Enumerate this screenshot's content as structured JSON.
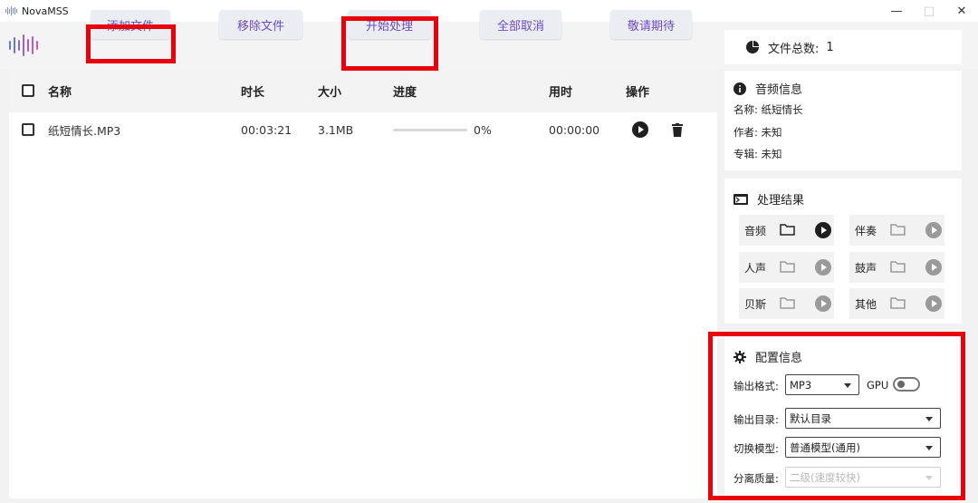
{
  "window": {
    "title": "NovaMSS",
    "minimize": "—",
    "maximize": "□",
    "close": "✕"
  },
  "toolbar": {
    "add_file": "添加文件",
    "remove_file": "移除文件",
    "start_process": "开始处理",
    "cancel_all": "全部取消",
    "coming_soon": "敬请期待"
  },
  "file_count": {
    "label": "文件总数:",
    "value": "1"
  },
  "table": {
    "headers": [
      "名称",
      "时长",
      "大小",
      "进度",
      "用时",
      "操作"
    ],
    "rows": [
      {
        "name": "纸短情长.MP3",
        "duration": "00:03:21",
        "size": "3.1MB",
        "progress": 0,
        "progress_text": "0%",
        "elapsed": "00:00:00"
      }
    ]
  },
  "audio_info": {
    "title": "音频信息",
    "name_line": "名称:  纸短情长",
    "author_line": "作者:  未知",
    "album_line": "专辑:  未知"
  },
  "results": {
    "title": "处理结果",
    "items": [
      "音频",
      "伴奏",
      "人声",
      "鼓声",
      "贝斯",
      "其他"
    ]
  },
  "config": {
    "title": "配置信息",
    "format_label": "输出格式:",
    "format_value": "MP3",
    "gpu_label": "GPU",
    "gpu_enabled": false,
    "dir_label": "输出目录:",
    "dir_value": "默认目录",
    "model_label": "切换模型:",
    "model_value": "普通模型(通用)",
    "quality_label": "分离质量:",
    "quality_value": "二级(速度较快)"
  },
  "colors": {
    "accent": "#6a4bc4",
    "highlight_box": "#e8000b",
    "button_bg": "#ececf3"
  }
}
